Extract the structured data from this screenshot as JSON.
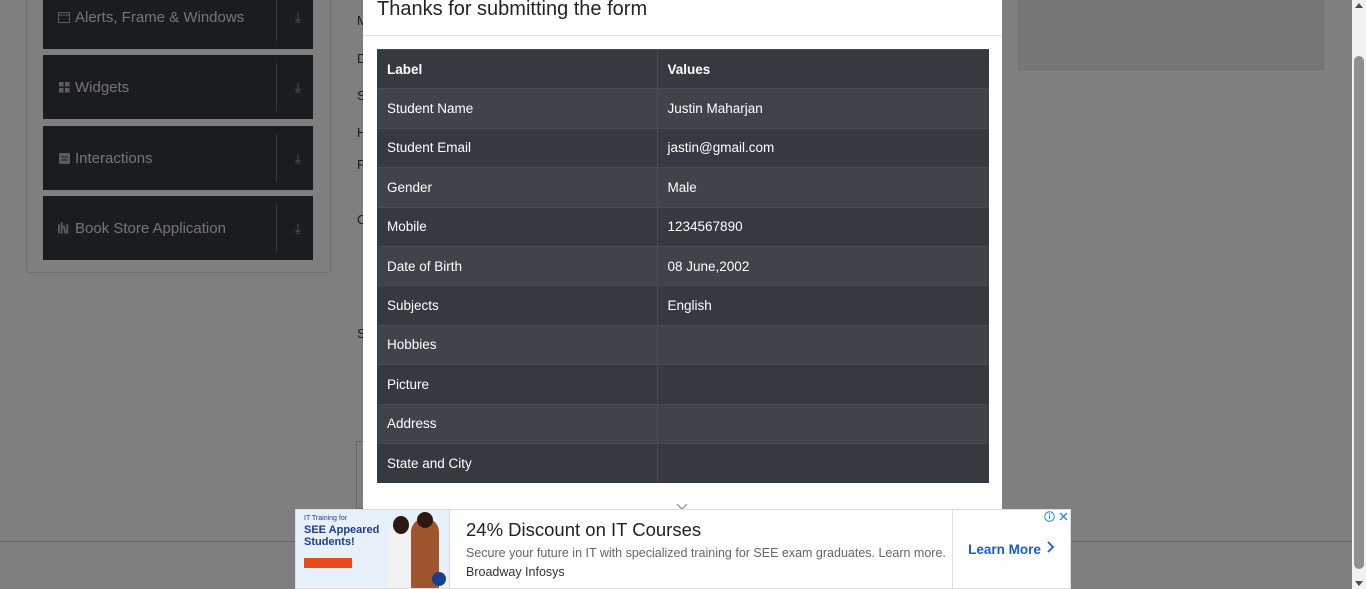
{
  "sidebar": {
    "groups": [
      {
        "label": "Alerts, Frame & Windows",
        "icon": "window-icon"
      },
      {
        "label": "Widgets",
        "icon": "widgets-icon"
      },
      {
        "label": "Interactions",
        "icon": "interactions-icon"
      },
      {
        "label": "Book Store Application",
        "icon": "book-icon"
      }
    ]
  },
  "background_letters": [
    "M",
    "D",
    "S",
    "H",
    "P",
    "C",
    "S"
  ],
  "modal": {
    "title": "Thanks for submitting the form",
    "table": {
      "headers": [
        "Label",
        "Values"
      ],
      "rows": [
        [
          "Student Name",
          "Justin Maharjan"
        ],
        [
          "Student Email",
          "jastin@gmail.com"
        ],
        [
          "Gender",
          "Male"
        ],
        [
          "Mobile",
          "1234567890"
        ],
        [
          "Date of Birth",
          "08 June,2002"
        ],
        [
          "Subjects",
          "English"
        ],
        [
          "Hobbies",
          ""
        ],
        [
          "Picture",
          ""
        ],
        [
          "Address",
          ""
        ],
        [
          "State and City",
          ""
        ]
      ]
    }
  },
  "ad": {
    "thumb_small": "IT Training for",
    "thumb_title": "SEE Appeared Students!",
    "headline": "24% Discount on IT Courses",
    "description": "Secure your future in IT with specialized training for SEE exam graduates. Learn more.",
    "brand": "Broadway Infosys",
    "cta": "Learn More"
  },
  "colors": {
    "sidebar_bg": "#343a40",
    "table_dark": "#343a40",
    "table_striped": "#3e444a",
    "cta_blue": "#1a5dc8"
  }
}
